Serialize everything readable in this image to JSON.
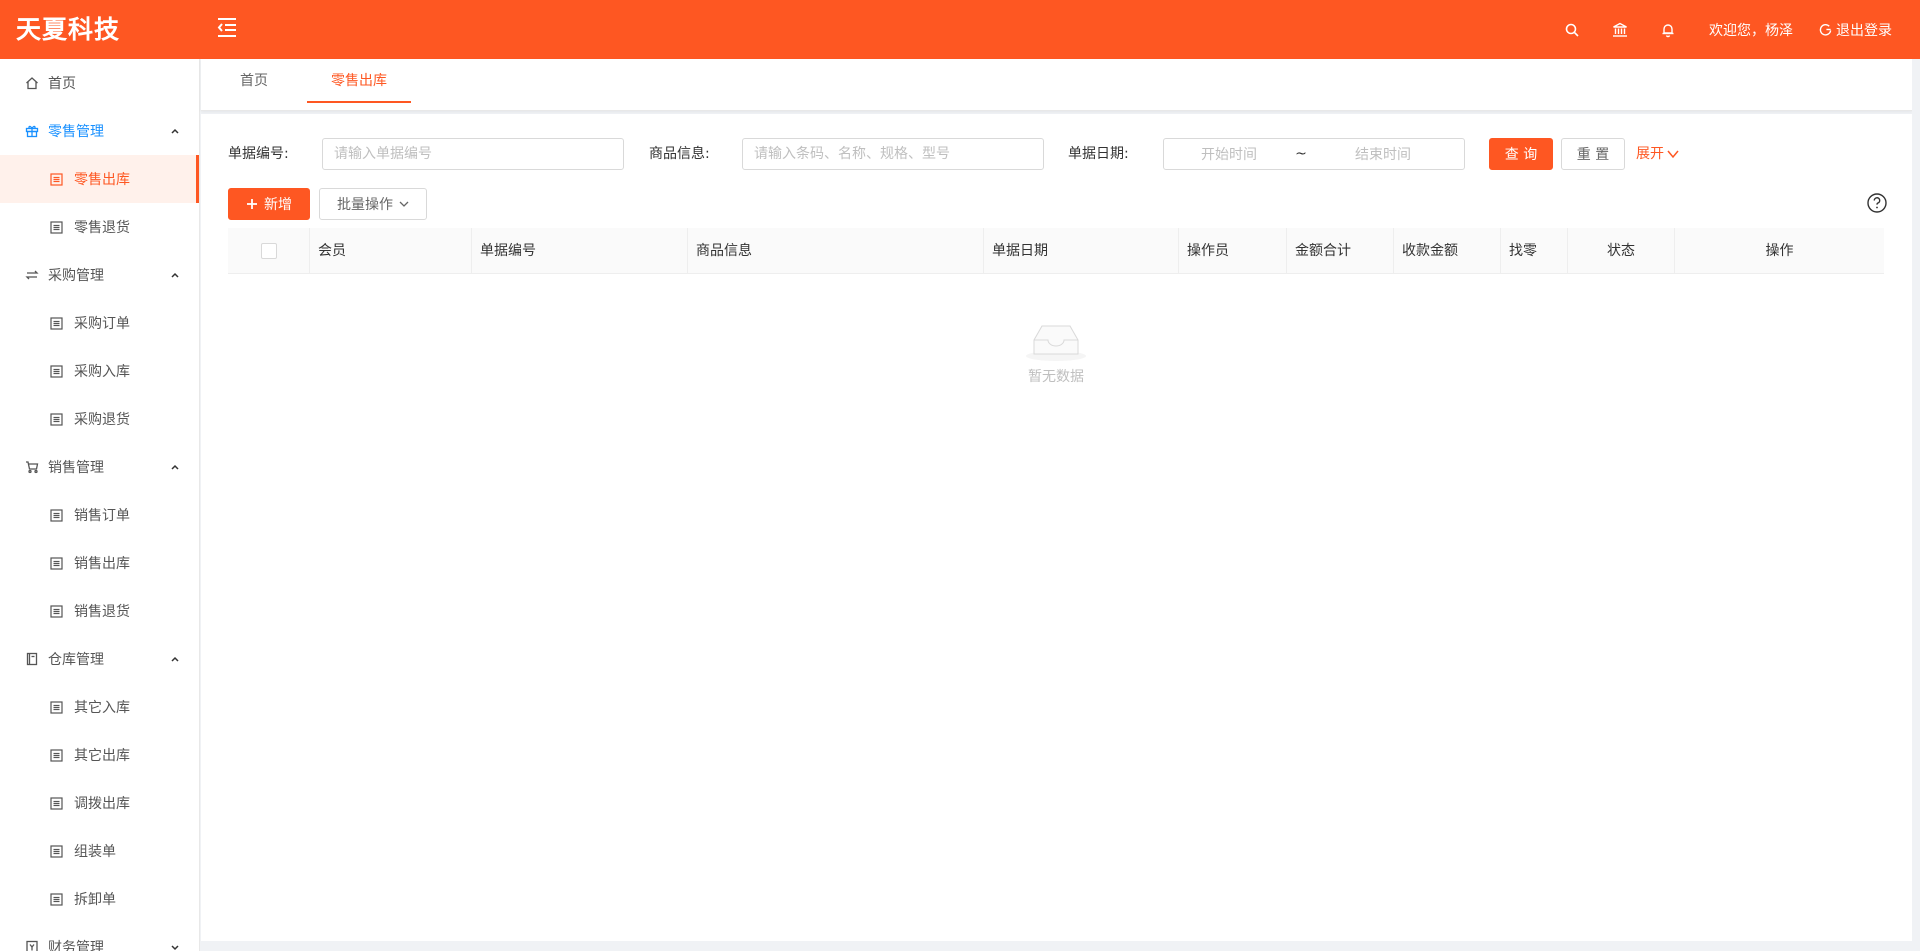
{
  "app": {
    "title": "天夏科技",
    "brand_color": "#fe5722",
    "accent_blue": "#1890ff"
  },
  "header": {
    "menu_icon": "menu-fold-icon",
    "icons": [
      "search-icon",
      "bank-icon",
      "bell-icon"
    ],
    "welcome": "欢迎您，杨泽",
    "logout": "退出登录"
  },
  "sidebar": {
    "items": [
      {
        "label": "首页",
        "icon": "home-icon",
        "level": 1
      },
      {
        "label": "零售管理",
        "icon": "gift-icon",
        "level": 1,
        "expanded": true
      },
      {
        "label": "零售出库",
        "icon": "list-icon",
        "level": 2,
        "active": true
      },
      {
        "label": "零售退货",
        "icon": "list-icon",
        "level": 2
      },
      {
        "label": "采购管理",
        "icon": "swap-icon",
        "level": 1,
        "expanded": true
      },
      {
        "label": "采购订单",
        "icon": "list-icon",
        "level": 2
      },
      {
        "label": "采购入库",
        "icon": "list-icon",
        "level": 2
      },
      {
        "label": "采购退货",
        "icon": "list-icon",
        "level": 2
      },
      {
        "label": "销售管理",
        "icon": "cart-icon",
        "level": 1,
        "expanded": true
      },
      {
        "label": "销售订单",
        "icon": "list-icon",
        "level": 2
      },
      {
        "label": "销售出库",
        "icon": "list-icon",
        "level": 2
      },
      {
        "label": "销售退货",
        "icon": "list-icon",
        "level": 2
      },
      {
        "label": "仓库管理",
        "icon": "book-icon",
        "level": 1,
        "expanded": true
      },
      {
        "label": "其它入库",
        "icon": "list-icon",
        "level": 2
      },
      {
        "label": "其它出库",
        "icon": "list-icon",
        "level": 2
      },
      {
        "label": "调拨出库",
        "icon": "list-icon",
        "level": 2
      },
      {
        "label": "组装单",
        "icon": "list-icon",
        "level": 2
      },
      {
        "label": "拆卸单",
        "icon": "list-icon",
        "level": 2
      },
      {
        "label": "财务管理",
        "icon": "account-book-icon",
        "level": 1,
        "expanded": false
      }
    ]
  },
  "tabs": {
    "home": "首页",
    "current": "零售出库"
  },
  "search": {
    "bill_no_label": "单据编号:",
    "bill_no_placeholder": "请输入单据编号",
    "product_label": "商品信息:",
    "product_placeholder": "请输入条码、名称、规格、型号",
    "date_label": "单据日期:",
    "date_start": "开始时间",
    "date_sep": "~",
    "date_end": "结束时间",
    "query": "查 询",
    "reset": "重 置",
    "expand": "展开"
  },
  "toolbar": {
    "add": "新增",
    "batch": "批量操作"
  },
  "table": {
    "columns": [
      "会员",
      "单据编号",
      "商品信息",
      "单据日期",
      "操作员",
      "金额合计",
      "收款金额",
      "找零",
      "状态",
      "操作"
    ],
    "empty_text": "暂无数据"
  }
}
